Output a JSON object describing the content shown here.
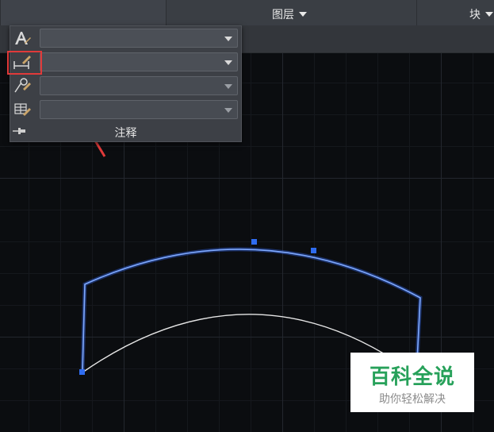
{
  "ribbon": {
    "groups": [
      {
        "label": "图层"
      },
      {
        "label": "块"
      }
    ]
  },
  "annotation_panel": {
    "rows": [
      {
        "icon": "text-style-icon",
        "value": ""
      },
      {
        "icon": "dimension-style-icon",
        "value": ""
      },
      {
        "icon": "multileader-style-icon",
        "value": ""
      },
      {
        "icon": "table-style-icon",
        "value": ""
      }
    ],
    "title": "注释"
  },
  "colors": {
    "accent_highlight": "#e03a3a",
    "selected_arc": "#6a9cff",
    "arc": "#e8e8e8",
    "watermark_green": "#27a15a"
  },
  "watermark": {
    "title": "百科全说",
    "subtitle": "助你轻松解决"
  }
}
